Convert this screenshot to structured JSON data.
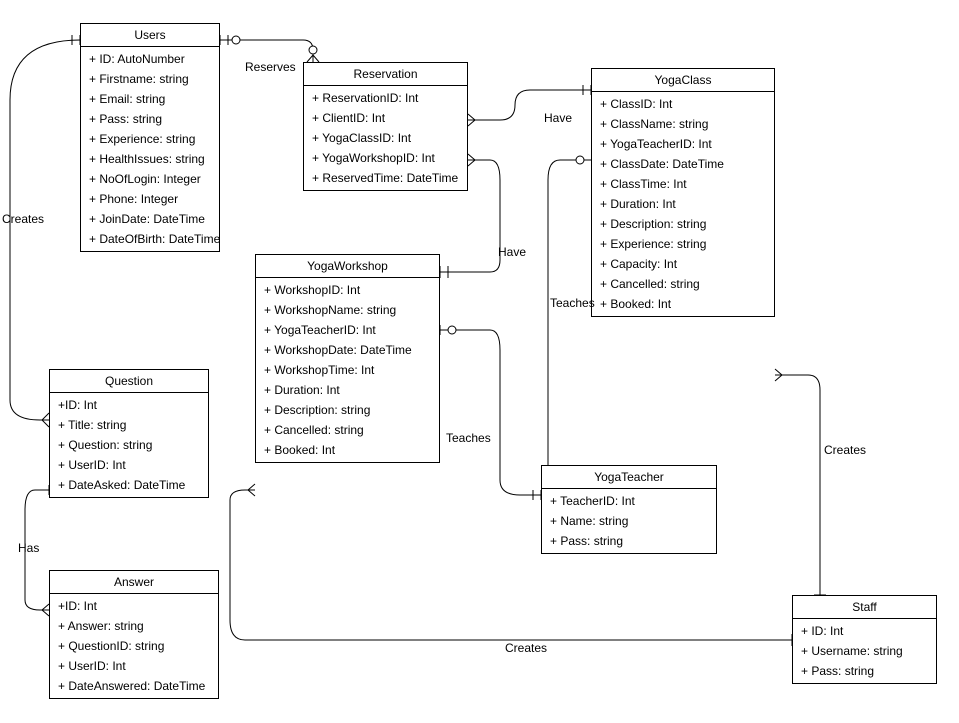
{
  "entities": {
    "users": {
      "title": "Users",
      "attrs": [
        "+ ID: AutoNumber",
        "+ Firstname: string",
        "+ Email: string",
        "+ Pass: string",
        "+ Experience: string",
        "+ HealthIssues: string",
        "+ NoOfLogin: Integer",
        "+ Phone: Integer",
        "+ JoinDate: DateTime",
        "+ DateOfBirth: DateTime"
      ]
    },
    "reservation": {
      "title": "Reservation",
      "attrs": [
        "+ ReservationID: Int",
        "+ ClientID: Int",
        "+ YogaClassID: Int",
        "+ YogaWorkshopID: Int",
        "+ ReservedTime: DateTime"
      ]
    },
    "yogaclass": {
      "title": "YogaClass",
      "attrs": [
        "+ ClassID: Int",
        "+ ClassName: string",
        "+ YogaTeacherID: Int",
        "+ ClassDate: DateTime",
        "+ ClassTime: Int",
        "+ Duration: Int",
        "+ Description: string",
        "+ Experience: string",
        "+ Capacity: Int",
        "+ Cancelled: string",
        "+ Booked: Int"
      ]
    },
    "yogaworkshop": {
      "title": "YogaWorkshop",
      "attrs": [
        "+ WorkshopID: Int",
        "+ WorkshopName: string",
        "+ YogaTeacherID: Int",
        "+ WorkshopDate: DateTime",
        "+ WorkshopTime: Int",
        "+ Duration: Int",
        "+ Description: string",
        "+ Cancelled: string",
        "+ Booked: Int"
      ]
    },
    "question": {
      "title": "Question",
      "attrs": [
        "+ID: Int",
        "+ Title: string",
        "+ Question: string",
        "+ UserID: Int",
        "+ DateAsked: DateTime"
      ]
    },
    "answer": {
      "title": "Answer",
      "attrs": [
        "+ID: Int",
        "+ Answer: string",
        "+ QuestionID: string",
        "+ UserID: Int",
        "+ DateAnswered: DateTime"
      ]
    },
    "yogateacher": {
      "title": "YogaTeacher",
      "attrs": [
        "+ TeacherID: Int",
        "+ Name: string",
        "+ Pass: string"
      ]
    },
    "staff": {
      "title": "Staff",
      "attrs": [
        "+ ID: Int",
        "+ Username: string",
        "+ Pass: string"
      ]
    }
  },
  "rels": {
    "creates1": "Creates",
    "reserves": "Reserves",
    "have1": "Have",
    "have2": "Have",
    "teaches1": "Teaches",
    "teaches2": "Teaches",
    "creates2": "Creates",
    "creates3": "Creates",
    "has": "Has"
  }
}
